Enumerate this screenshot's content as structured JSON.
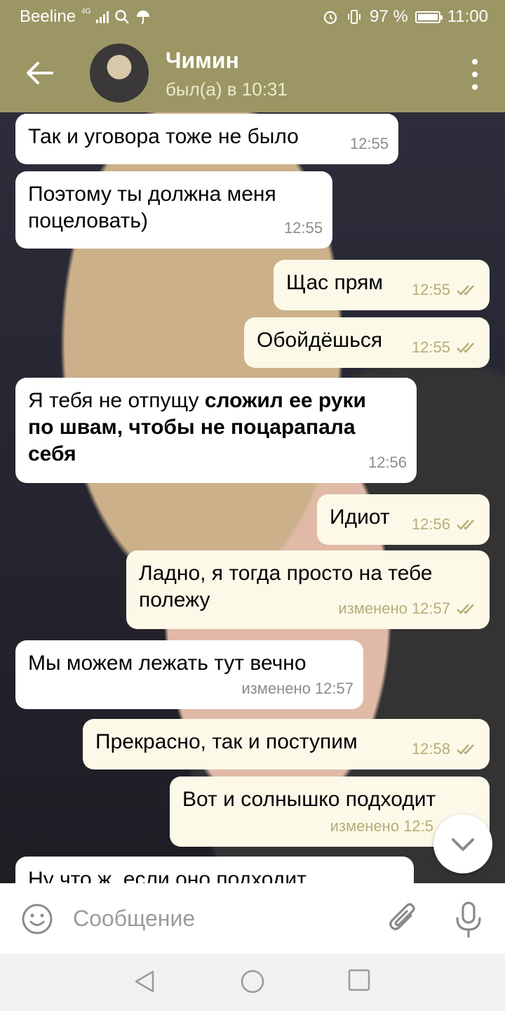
{
  "status_bar": {
    "carrier": "Beeline",
    "network": "4G",
    "battery": "97 %",
    "battery_level": 0.97,
    "time": "11:00"
  },
  "header": {
    "contact_name": "Чимин",
    "last_seen": "был(а) в 10:31"
  },
  "messages": [
    {
      "direction": "in",
      "text": "Так и уговора тоже не было",
      "time": "12:55"
    },
    {
      "direction": "in",
      "text_line1": "Поэтому ты должна меня",
      "text_line2": "поцеловать)",
      "time": "12:55"
    },
    {
      "direction": "out",
      "text": "Щас прям",
      "time": "12:55"
    },
    {
      "direction": "out",
      "text": "Обойдёшься",
      "time": "12:55"
    },
    {
      "direction": "in",
      "text_plain": "Я тебя не отпущу ",
      "text_bold_line1": "сложил ее руки",
      "text_bold_line2": "по швам, чтобы не поцарапала",
      "text_bold_line3": "себя",
      "time": "12:56"
    },
    {
      "direction": "out",
      "text": "Идиот",
      "time": "12:56"
    },
    {
      "direction": "out",
      "text_line1": "Ладно, я тогда просто на тебе",
      "text_line2": "полежу",
      "time": "изменено 12:57"
    },
    {
      "direction": "in",
      "text": "Мы можем лежать тут вечно",
      "time": "изменено 12:57"
    },
    {
      "direction": "out",
      "text": "Прекрасно, так и поступим",
      "time": "12:58"
    },
    {
      "direction": "out",
      "text": "Вот и солнышко подходит",
      "time": "изменено 12:5"
    },
    {
      "direction": "in",
      "text": "Ну что ж, если оно подходит",
      "time": ""
    }
  ],
  "input": {
    "placeholder": "Сообщение"
  },
  "colors": {
    "accent": "#9b9664",
    "incoming_bubble": "#ffffff",
    "outgoing_bubble": "#fdf9e8",
    "check_color": "#b4ad78"
  },
  "icons": [
    "back-arrow-icon",
    "kebab-menu-icon",
    "double-check-icon",
    "chevron-down-icon",
    "emoji-icon",
    "attach-icon",
    "mic-icon",
    "nav-back-icon",
    "nav-home-icon",
    "nav-recents-icon"
  ]
}
